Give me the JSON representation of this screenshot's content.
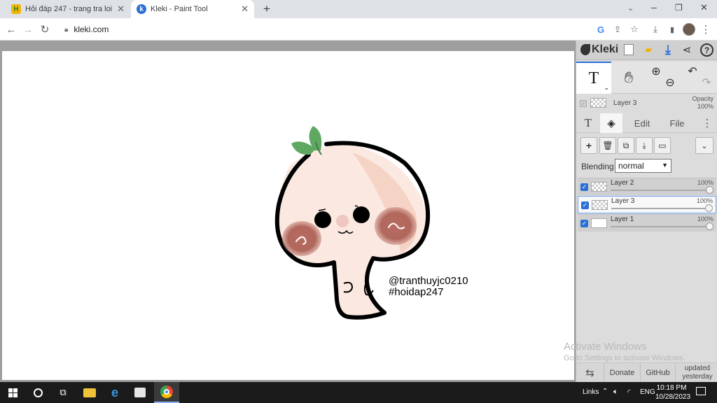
{
  "browser": {
    "tabs": [
      {
        "title": "Hỏi đáp 247 - trang tra loi",
        "favicon": "H",
        "active": false
      },
      {
        "title": "Kleki - Paint Tool",
        "favicon": "k",
        "active": true
      }
    ],
    "url": "kleki.com"
  },
  "canvas": {
    "caption_line1": "@tranthuyjc0210",
    "caption_line2": "#hoidap247"
  },
  "kleki": {
    "logo": "Kleki",
    "current_layer_name": "Layer 3",
    "opacity_label": "Opacity",
    "opacity_value": "100%",
    "tabs": {
      "edit": "Edit",
      "file": "File"
    },
    "blending_label": "Blending",
    "blending_value": "normal",
    "layers": [
      {
        "name": "Layer 2",
        "opacity": "100%",
        "opacity_fraction": 1.0,
        "visible": true,
        "selected": false
      },
      {
        "name": "Layer 3",
        "opacity": "100%",
        "opacity_fraction": 1.0,
        "visible": true,
        "selected": true
      },
      {
        "name": "Layer 1",
        "opacity": "100%",
        "opacity_fraction": 1.0,
        "visible": true,
        "selected": false
      }
    ],
    "footer": {
      "donate": "Donate",
      "github": "GitHub",
      "updated_line1": "updated",
      "updated_line2": "yesterday"
    }
  },
  "watermark": {
    "line1": "Activate Windows",
    "line2": "Go to Settings to activate Windows."
  },
  "taskbar": {
    "links_label": "Links",
    "language": "ENG",
    "time": "10:18 PM",
    "date": "10/28/2023"
  },
  "colors": {
    "kleki_accent": "#2c6fd6",
    "sprout_green": "#5fa862",
    "cheek": "#b0675c",
    "taskbar": "#1b1b1b"
  }
}
